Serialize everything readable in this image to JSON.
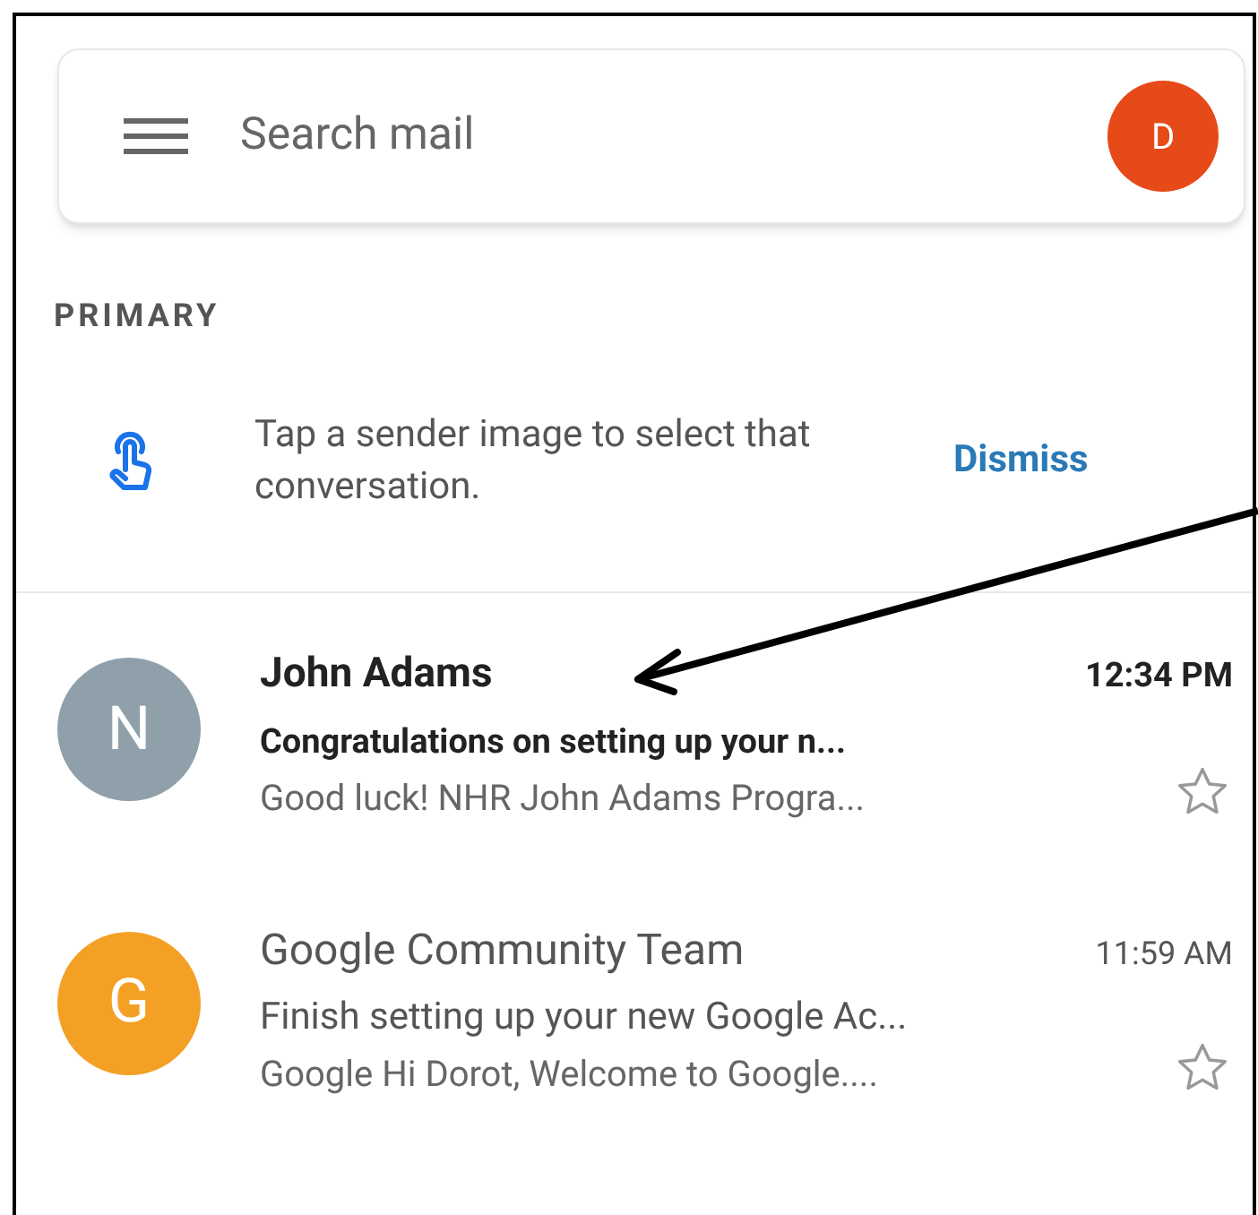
{
  "search": {
    "placeholder": "Search mail",
    "avatar_letter": "D"
  },
  "section": "PRIMARY",
  "tip": {
    "text": "Tap a sender image to select that conversation.",
    "action": "Dismiss"
  },
  "emails": [
    {
      "avatar_letter": "N",
      "color": "#8fa0ab",
      "sender": "John Adams",
      "time": "12:34 PM",
      "subject": "Congratulations on setting up your n...",
      "snippet": "Good luck! NHR John Adams Progra...",
      "unread": true,
      "starred": false
    },
    {
      "avatar_letter": "G",
      "color": "#f4a025",
      "sender": "Google Community Team",
      "time": "11:59 AM",
      "subject": "Finish setting up your new Google Ac...",
      "snippet": "Google Hi Dorot, Welcome to Google....",
      "unread": false,
      "starred": false
    }
  ]
}
